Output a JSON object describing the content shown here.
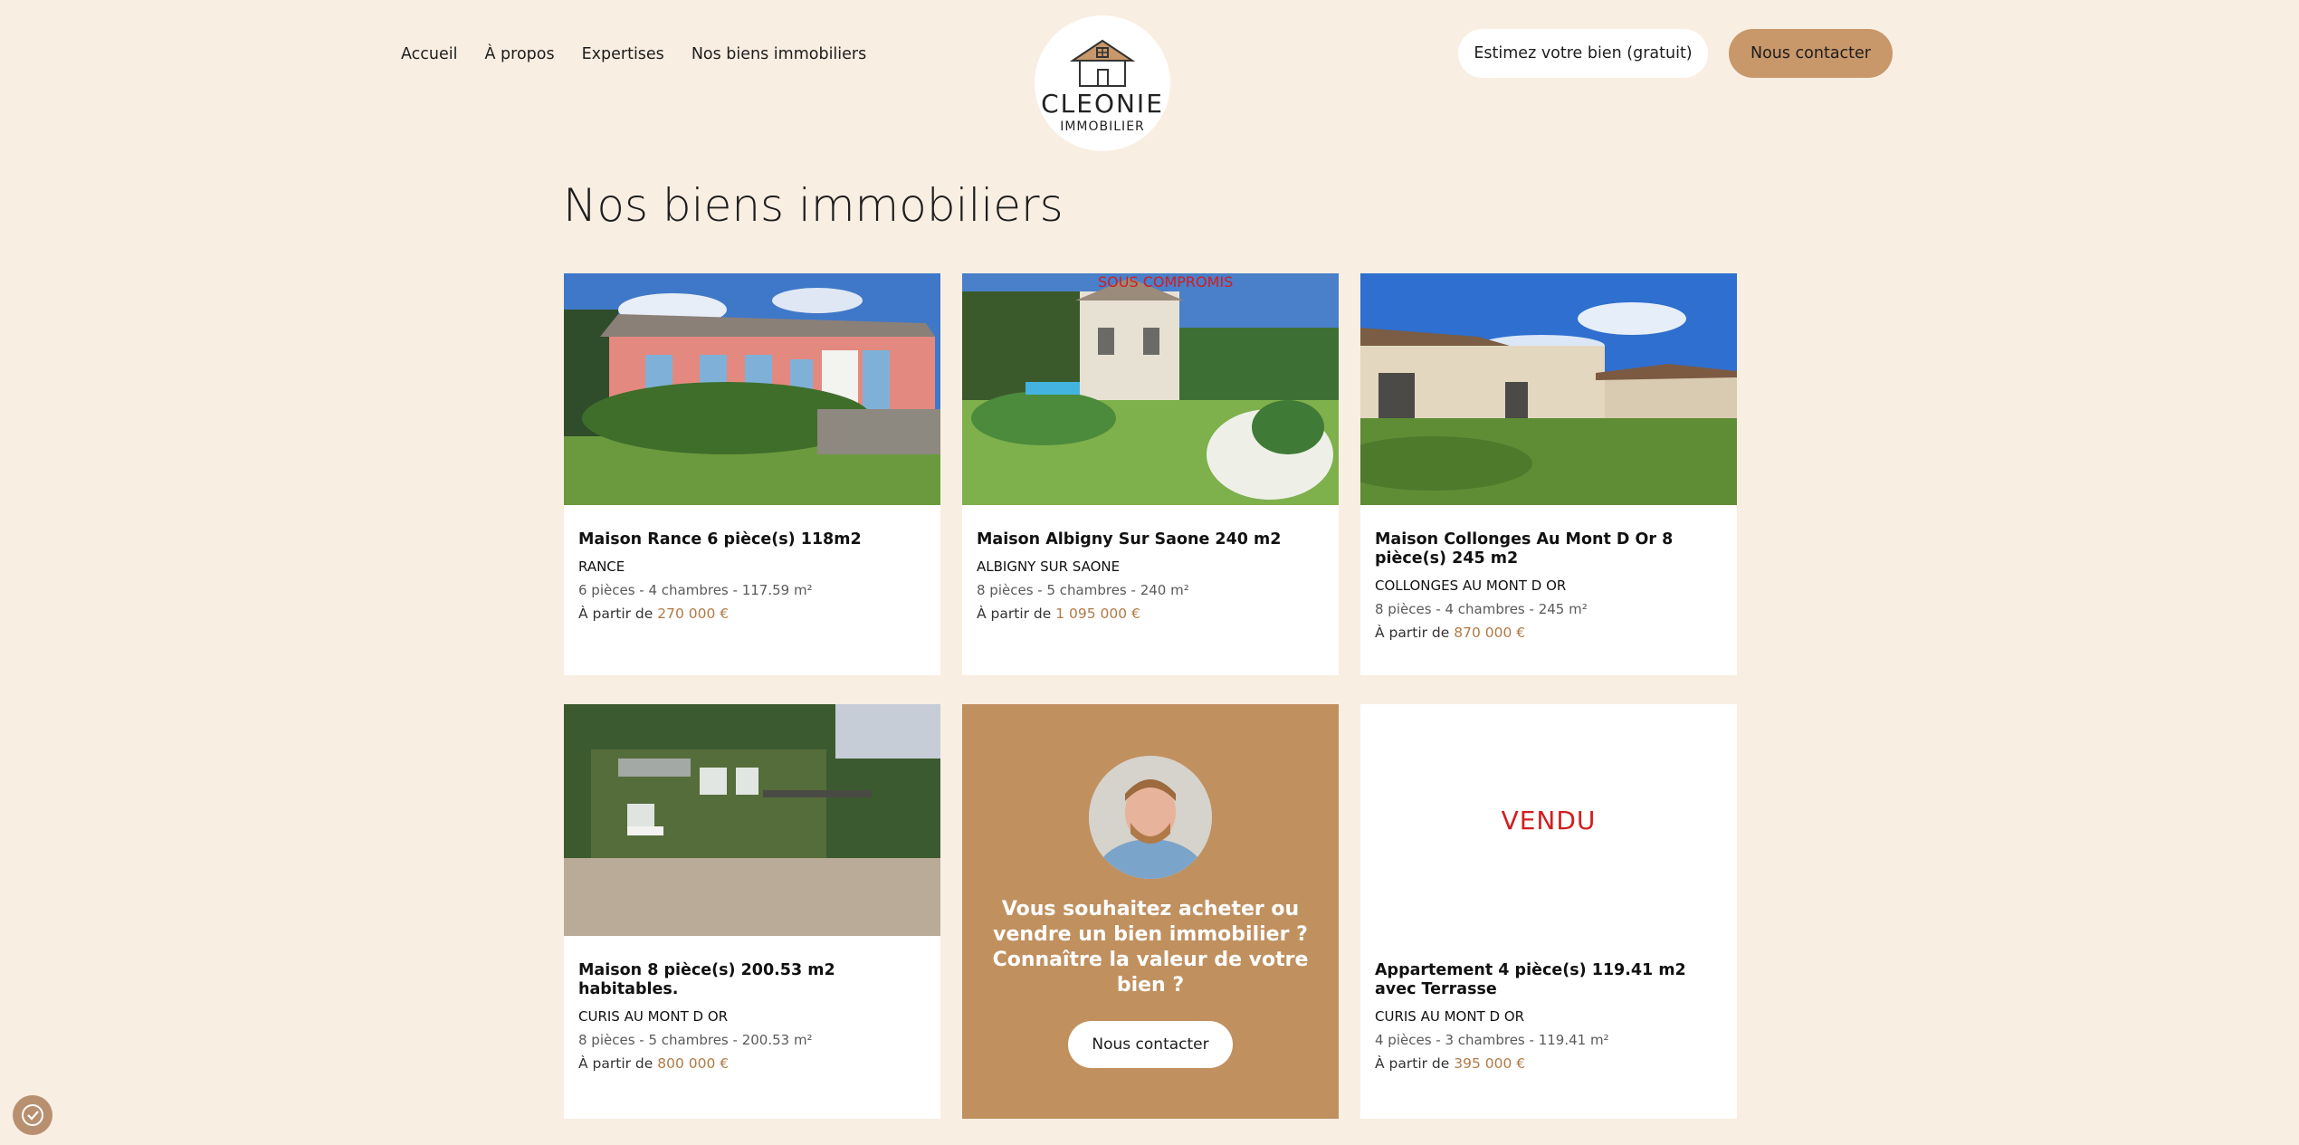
{
  "nav": {
    "items": [
      "Accueil",
      "À propos",
      "Expertises",
      "Nos biens immobiliers"
    ]
  },
  "logo": {
    "line1": "CLEONIE",
    "line2": "IMMOBILIER"
  },
  "header": {
    "estimate_label": "Estimez votre bien (gratuit)",
    "contact_label": "Nous contacter"
  },
  "page": {
    "title": "Nos biens immobiliers"
  },
  "listings": [
    {
      "title": "Maison Rance 6 pièce(s) 118m2",
      "city": "RANCE",
      "details": "6 pièces - 4 chambres - 117.59 m²",
      "price_prefix": "À partir de",
      "price": "270 000 €"
    },
    {
      "title": "Maison Albigny Sur Saone 240 m2",
      "city": "ALBIGNY SUR SAONE",
      "details": "8 pièces - 5 chambres - 240 m²",
      "price_prefix": "À partir de",
      "price": "1 095 000 €",
      "overlay": "SOUS COMPROMIS"
    },
    {
      "title": "Maison Collonges Au Mont D Or 8 pièce(s) 245 m2",
      "city": "COLLONGES AU MONT D OR",
      "details": "8 pièces - 4 chambres - 245 m²",
      "price_prefix": "À partir de",
      "price": "870 000 €"
    },
    {
      "title": "Maison 8 pièce(s) 200.53 m2 habitables.",
      "city": "CURIS AU MONT D OR",
      "details": "8 pièces - 5 chambres - 200.53 m²",
      "price_prefix": "À partir de",
      "price": "800 000 €"
    },
    {
      "title": "Appartement 4 pièce(s) 119.41 m2 avec Terrasse",
      "city": "CURIS AU MONT D OR",
      "details": "4 pièces - 3 chambres - 119.41 m²",
      "price_prefix": "À partir de",
      "price": "395 000 €",
      "overlay": "VENDU"
    }
  ],
  "promo": {
    "text": "Vous souhaitez acheter ou vendre un bien immobilier ? Connaître la valeur de votre bien ?",
    "button_label": "Nous contacter"
  },
  "colors": {
    "background": "#f9eee2",
    "accent": "#c8976a",
    "promo_bg": "#c0905f",
    "price": "#b17a45",
    "sold_red": "#d21e1e"
  },
  "icons": {
    "cookie": "cookie-settings-icon",
    "logo": "house-icon"
  }
}
